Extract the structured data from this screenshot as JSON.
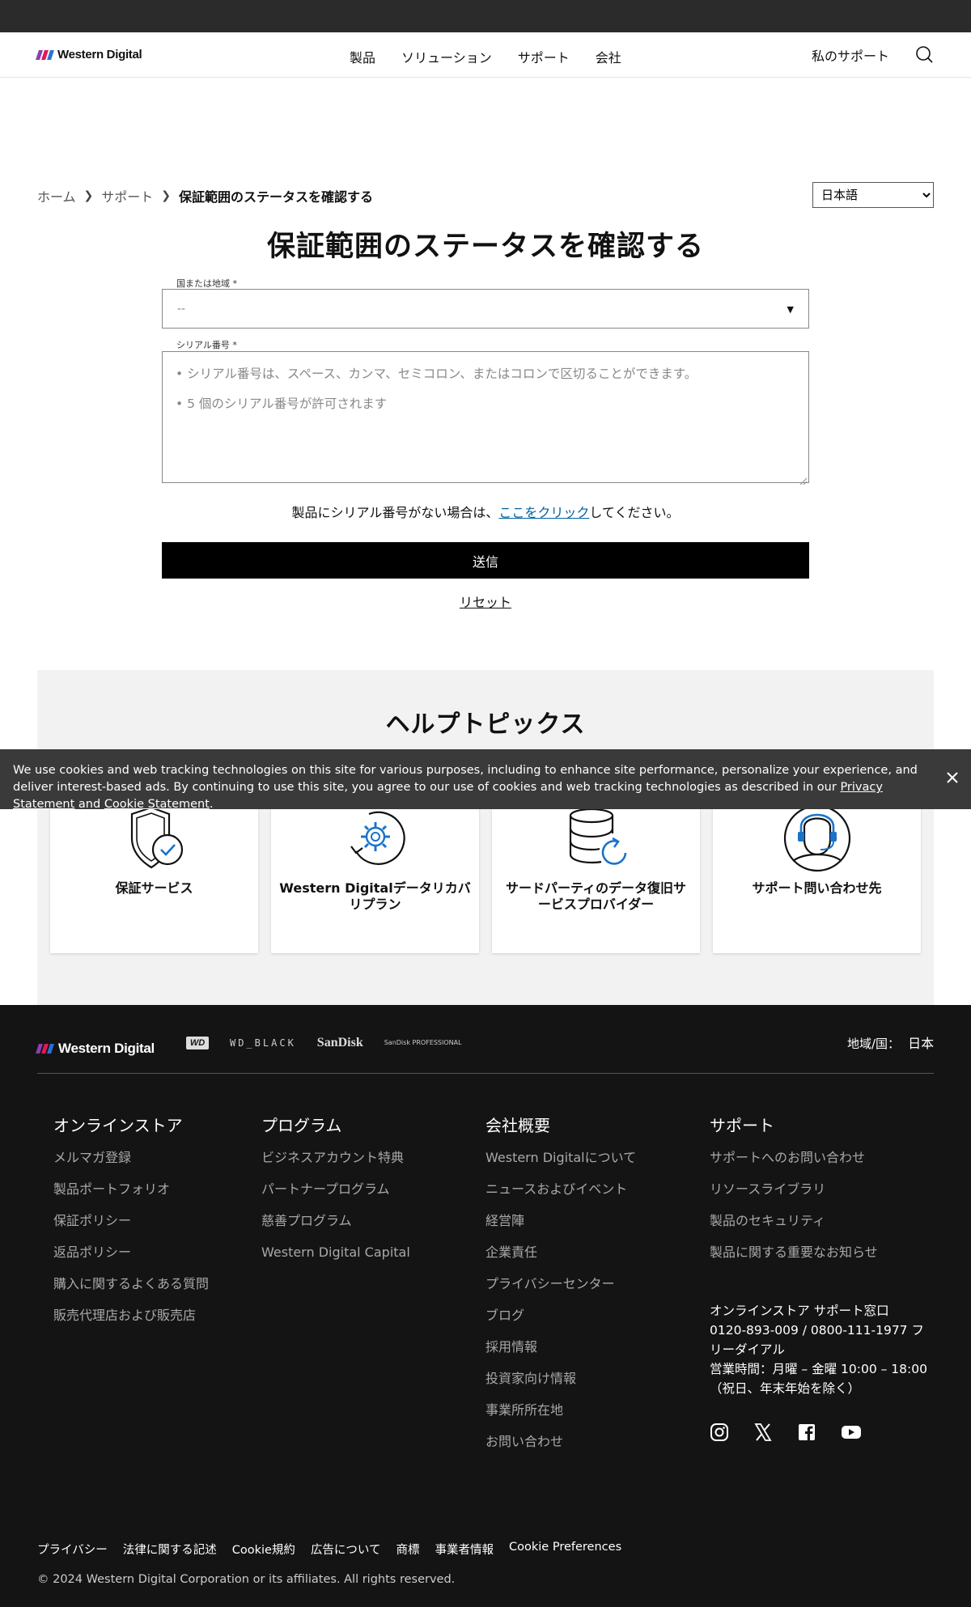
{
  "brand": {
    "name": "Western Digital",
    "colors": [
      "#8b3fb0",
      "#e0195a",
      "#2d6fd6"
    ]
  },
  "nav": {
    "items": [
      "製品",
      "ソリューション",
      "サポート",
      "会社"
    ],
    "my_support": "私のサポート",
    "search_icon": "search-icon"
  },
  "breadcrumb": {
    "items": [
      "ホーム",
      "サポート"
    ],
    "current": "保証範囲のステータスを確認する"
  },
  "language": {
    "selected": "日本語"
  },
  "form": {
    "title": "保証範囲のステータスを確認する",
    "country_label": "国または地域 *",
    "country_value": "--",
    "serial_label": "シリアル番号 *",
    "serial_placeholder_1": "• シリアル番号は、スペース、カンマ、セミコロン、またはコロンで区切ることができます。",
    "serial_placeholder_2": "• 5 個のシリアル番号が許可されます",
    "help_prefix": "製品にシリアル番号がない場合は、",
    "help_link": "ここをクリック",
    "help_suffix": "してください。",
    "submit": "送信",
    "reset": "リセット"
  },
  "help_topics": {
    "title": "ヘルプトピックス",
    "cards": [
      {
        "label": "保証サービス",
        "icon": "shield-check-icon"
      },
      {
        "label": "Western Digitalデータリカバリプラン",
        "icon": "gear-refresh-icon"
      },
      {
        "label": "サードパーティのデータ復旧サービスプロバイダー",
        "icon": "database-refresh-icon"
      },
      {
        "label": "サポート問い合わせ先",
        "icon": "headset-agent-icon"
      }
    ]
  },
  "cookie": {
    "text": "We use cookies and web tracking technologies on this site for various purposes, including to enhance site performance, personalize your experience, and deliver interest-based ads. By continuing to use this site, you agree to our use of cookies and web tracking technologies as described in our ",
    "privacy_link": "Privacy Statement",
    "and": " and ",
    "cookie_link": "Cookie Statement",
    "end": "."
  },
  "footer": {
    "brands": [
      "WD",
      "WD_BLACK",
      "SanDisk",
      "SanDisk PROFESSIONAL"
    ],
    "region_label": "地域/国：",
    "region_value": "日本",
    "columns": [
      {
        "title": "オンラインストア",
        "items": [
          "メルマガ登録",
          "製品ポートフォリオ",
          "保証ポリシー",
          "返品ポリシー",
          "購入に関するよくある質問",
          "販売代理店および販売店"
        ]
      },
      {
        "title": "プログラム",
        "items": [
          "ビジネスアカウント特典",
          "パートナープログラム",
          "慈善プログラム",
          "Western Digital Capital"
        ]
      },
      {
        "title": "会社概要",
        "items": [
          "Western Digitalについて",
          "ニュースおよびイベント",
          "経営陣",
          "企業責任",
          "プライバシーセンター",
          "ブログ",
          "採用情報",
          "投資家向け情報",
          "事業所所在地",
          "お問い合わせ"
        ]
      },
      {
        "title": "サポート",
        "items": [
          "サポートへのお問い合わせ",
          "リソースライブラリ",
          "製品のセキュリティ",
          "製品に関する重要なお知らせ"
        ]
      }
    ],
    "contact": {
      "line1": "オンラインストア サポート窓口",
      "line2": "0120-893-009 / 0800-111-1977 フリーダイアル",
      "line3": "営業時間：月曜 – 金曜 10:00 – 18:00（祝日、年末年始を除く）"
    },
    "social": [
      "instagram-icon",
      "x-icon",
      "facebook-icon",
      "youtube-icon"
    ],
    "bottom_links": [
      "プライバシー",
      "法律に関する記述",
      "Cookie規約",
      "広告について",
      "商標",
      "事業者情報",
      "Cookie Preferences"
    ],
    "copyright": "© 2024 Western Digital Corporation or its affiliates. All rights reserved."
  }
}
